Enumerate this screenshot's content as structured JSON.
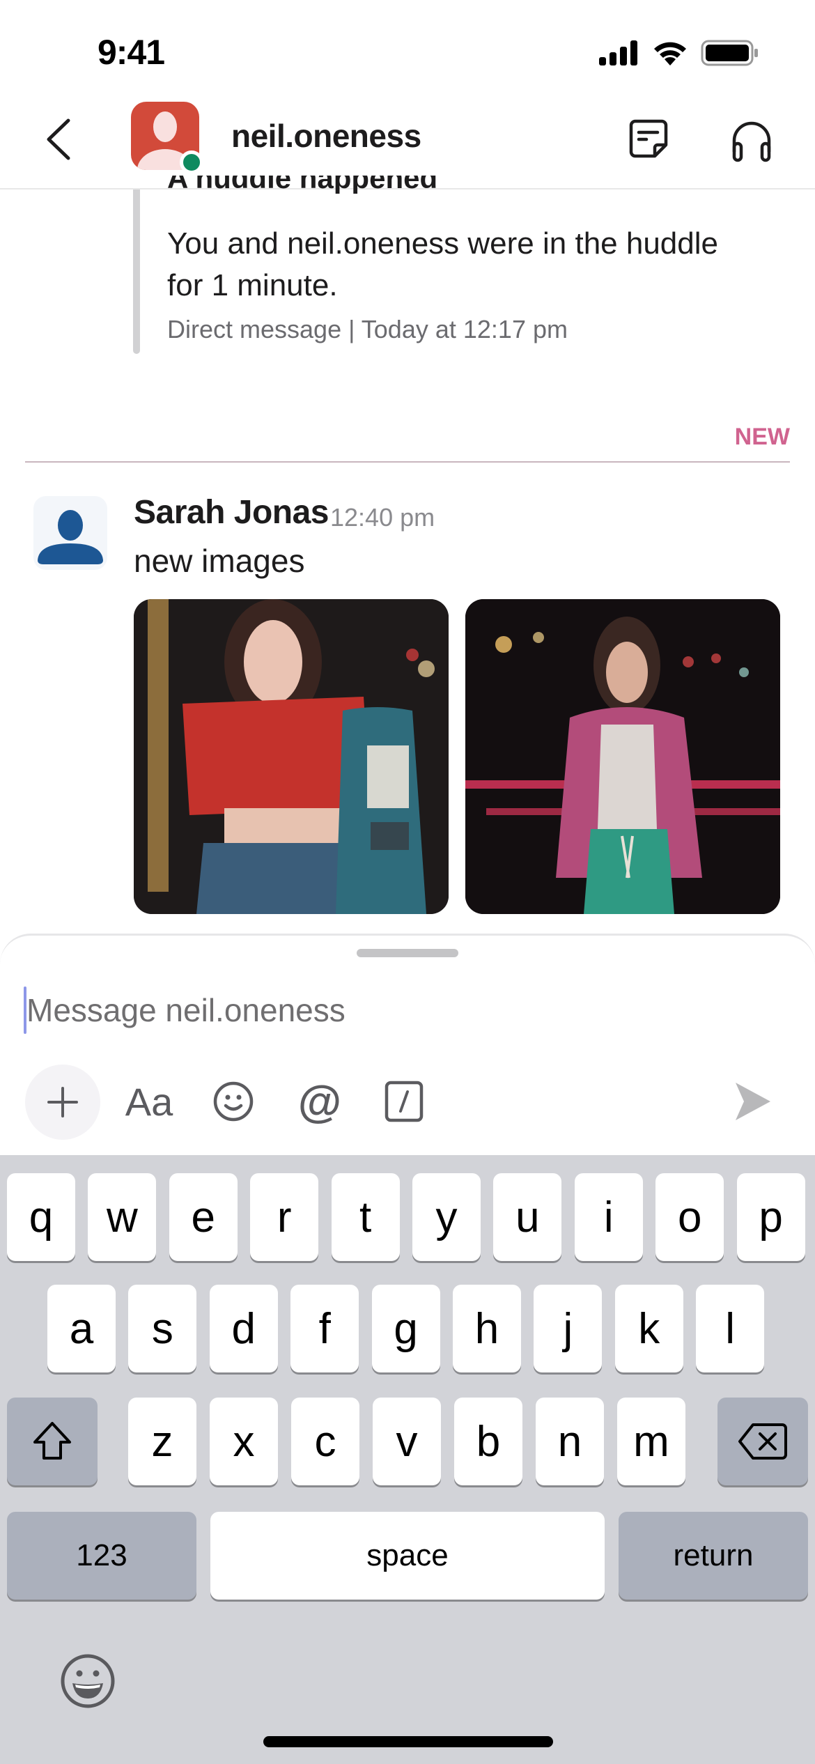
{
  "status_bar": {
    "time": "9:41",
    "icons": [
      "cellular-signal-icon",
      "wifi-icon",
      "battery-icon"
    ]
  },
  "header": {
    "back_icon": "chevron-left-icon",
    "title": "neil.oneness",
    "presence": "active",
    "actions": [
      {
        "name": "canvas-icon"
      },
      {
        "name": "headphones-icon"
      }
    ]
  },
  "huddle": {
    "title": "A huddle happened",
    "body": "You and neil.oneness were in the huddle for 1 minute.",
    "meta": "Direct message | Today at 12:17 pm"
  },
  "divider": {
    "label": "NEW"
  },
  "message": {
    "author": "Sarah Jonas",
    "time": "12:40 pm",
    "text": "new images",
    "images": [
      {
        "alt": "Woman in red crop top leaning on a parking meter at night"
      },
      {
        "alt": "Woman in pink satin jacket and green pants at night"
      }
    ]
  },
  "composer": {
    "placeholder": "Message neil.oneness",
    "value": "",
    "tools": [
      {
        "name": "plus-icon"
      },
      {
        "name": "format-text-icon",
        "label": "Aa"
      },
      {
        "name": "emoji-icon"
      },
      {
        "name": "mention-icon",
        "label": "@"
      },
      {
        "name": "slash-command-icon"
      }
    ],
    "send_icon": "send-icon"
  },
  "keyboard": {
    "row1": [
      "q",
      "w",
      "e",
      "r",
      "t",
      "y",
      "u",
      "i",
      "o",
      "p"
    ],
    "row2": [
      "a",
      "s",
      "d",
      "f",
      "g",
      "h",
      "j",
      "k",
      "l"
    ],
    "row3": [
      "z",
      "x",
      "c",
      "v",
      "b",
      "n",
      "m"
    ],
    "numbers_label": "123",
    "space_label": "space",
    "return_label": "return"
  },
  "colors": {
    "accent_new": "#d0638f",
    "presence": "#0f8a5f",
    "avatar_red": "#d24a3a",
    "avatar_blue": "#1d5794"
  }
}
